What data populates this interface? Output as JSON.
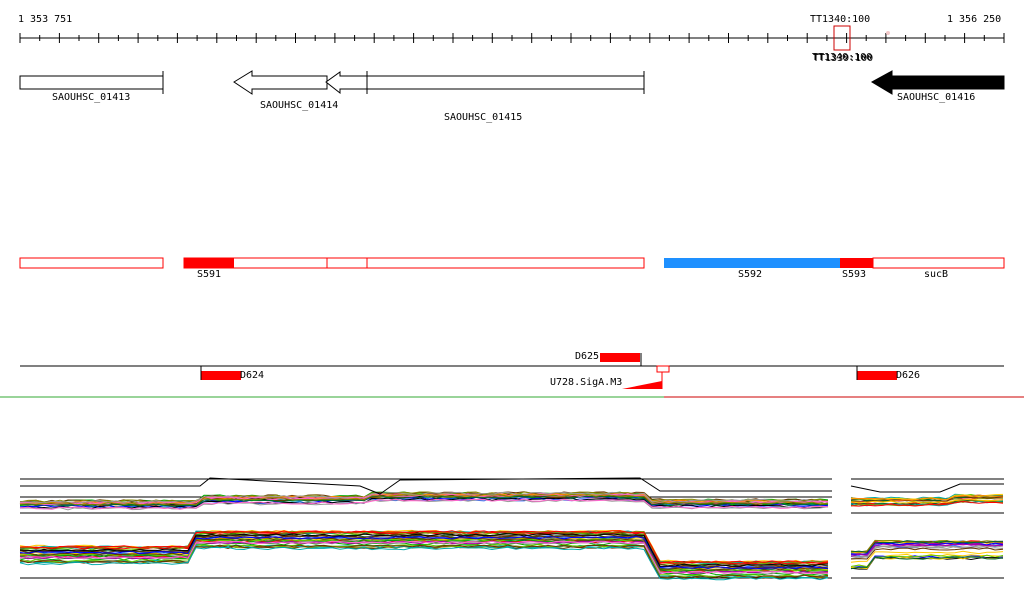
{
  "ruler": {
    "start_label": "1 353 751",
    "end_label": "1 356 250",
    "terminator_label": "TT1340:100",
    "terminator_overlap_label": "TT1339:100"
  },
  "genes": [
    {
      "label": "SAOUHSC_01413",
      "strand": "+",
      "style": "outline"
    },
    {
      "label": "SAOUHSC_01414",
      "strand": "-",
      "style": "outline"
    },
    {
      "label": "SAOUHSC_01415",
      "strand": "-",
      "style": "outline"
    },
    {
      "label": "SAOUHSC_01416",
      "strand": "-",
      "style": "filled"
    }
  ],
  "segments": [
    {
      "label": "S591",
      "color": "#ff0000"
    },
    {
      "label": "S592",
      "color": "#1e90ff"
    },
    {
      "label": "S593",
      "color": "#ff0000"
    },
    {
      "label": "sucB",
      "color": "#ff0000"
    }
  ],
  "features": [
    {
      "label": "D625"
    },
    {
      "label": "D624"
    },
    {
      "label": "D626"
    },
    {
      "label": "U728.SigA.M3"
    }
  ],
  "colors": {
    "gene_outline": "#000000",
    "segment_outline": "#ff0000",
    "segment_blue": "#1e90ff",
    "feature_red": "#ff0000",
    "green_line": "#33aa33",
    "red_line": "#cc0000"
  }
}
